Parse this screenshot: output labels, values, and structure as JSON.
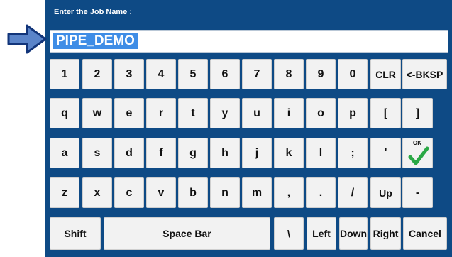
{
  "prompt_label": "Enter the Job Name :",
  "job_name_value": "PIPE_DEMO",
  "keys": {
    "row1": [
      "1",
      "2",
      "3",
      "4",
      "5",
      "6",
      "7",
      "8",
      "9",
      "0",
      "CLR",
      "<-BKSP"
    ],
    "row2": [
      "q",
      "w",
      "e",
      "r",
      "t",
      "y",
      "u",
      "i",
      "o",
      "p",
      "[",
      "]"
    ],
    "row3": [
      "a",
      "s",
      "d",
      "f",
      "g",
      "h",
      "j",
      "k",
      "l",
      ";",
      "'"
    ],
    "ok_label": "OK",
    "row4": [
      "z",
      "x",
      "c",
      "v",
      "b",
      "n",
      "m",
      ",",
      ".",
      "/",
      "Up",
      "-"
    ],
    "row5": {
      "shift": "Shift",
      "space": "Space Bar",
      "backslash": "\\",
      "left": "Left",
      "down": "Down",
      "right": "Right",
      "cancel": "Cancel"
    }
  },
  "icons": {
    "pointer_arrow": "arrow-right-icon",
    "ok_check": "checkmark-icon"
  },
  "colors": {
    "panel_bg": "#0e4a85",
    "selection": "#3f8de6",
    "arrow_fill": "#5a84c9",
    "arrow_stroke": "#12357a",
    "check_green": "#2aa845"
  }
}
